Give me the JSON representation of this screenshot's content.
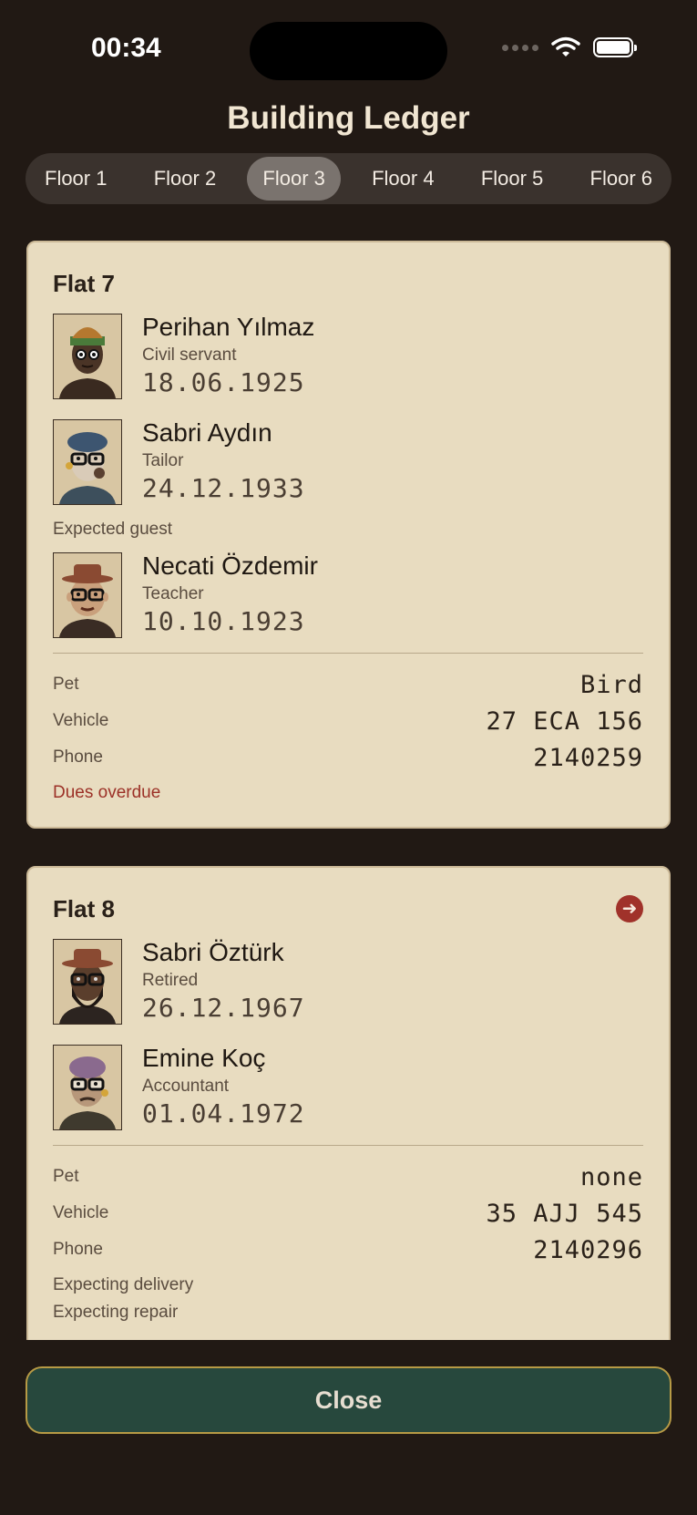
{
  "status": {
    "time": "00:34"
  },
  "app": {
    "title": "Building Ledger"
  },
  "tabs": [
    {
      "label": "Floor 1",
      "active": false
    },
    {
      "label": "Floor 2",
      "active": false
    },
    {
      "label": "Floor 3",
      "active": true
    },
    {
      "label": "Floor 4",
      "active": false
    },
    {
      "label": "Floor 5",
      "active": false
    },
    {
      "label": "Floor 6",
      "active": false
    }
  ],
  "flats": [
    {
      "title": "Flat 7",
      "residents": [
        {
          "name": "Perihan Yılmaz",
          "role": "Civil servant",
          "dob": "18.06.1925"
        },
        {
          "name": "Sabri Aydın",
          "role": "Tailor",
          "dob": "24.12.1933"
        }
      ],
      "guest_label": "Expected guest",
      "guest": {
        "name": "Necati Özdemir",
        "role": "Teacher",
        "dob": "10.10.1923"
      },
      "details": {
        "pet_label": "Pet",
        "pet": "Bird",
        "vehicle_label": "Vehicle",
        "vehicle": "27 ECA 156",
        "phone_label": "Phone",
        "phone": "2140259"
      },
      "flags": [
        "Dues overdue"
      ]
    },
    {
      "title": "Flat 8",
      "residents": [
        {
          "name": "Sabri Öztürk",
          "role": "Retired",
          "dob": "26.12.1967"
        },
        {
          "name": "Emine Koç",
          "role": "Accountant",
          "dob": "01.04.1972"
        }
      ],
      "details": {
        "pet_label": "Pet",
        "pet": "none",
        "vehicle_label": "Vehicle",
        "vehicle": "35 AJJ 545",
        "phone_label": "Phone",
        "phone": "2140296"
      },
      "flags": [
        "Expecting delivery",
        "Expecting repair"
      ]
    }
  ],
  "footer": {
    "close_label": "Close"
  },
  "colors": {
    "accent": "#27483d",
    "card": "#e8dcc0",
    "alert": "#9c3127",
    "background": "#211914"
  }
}
